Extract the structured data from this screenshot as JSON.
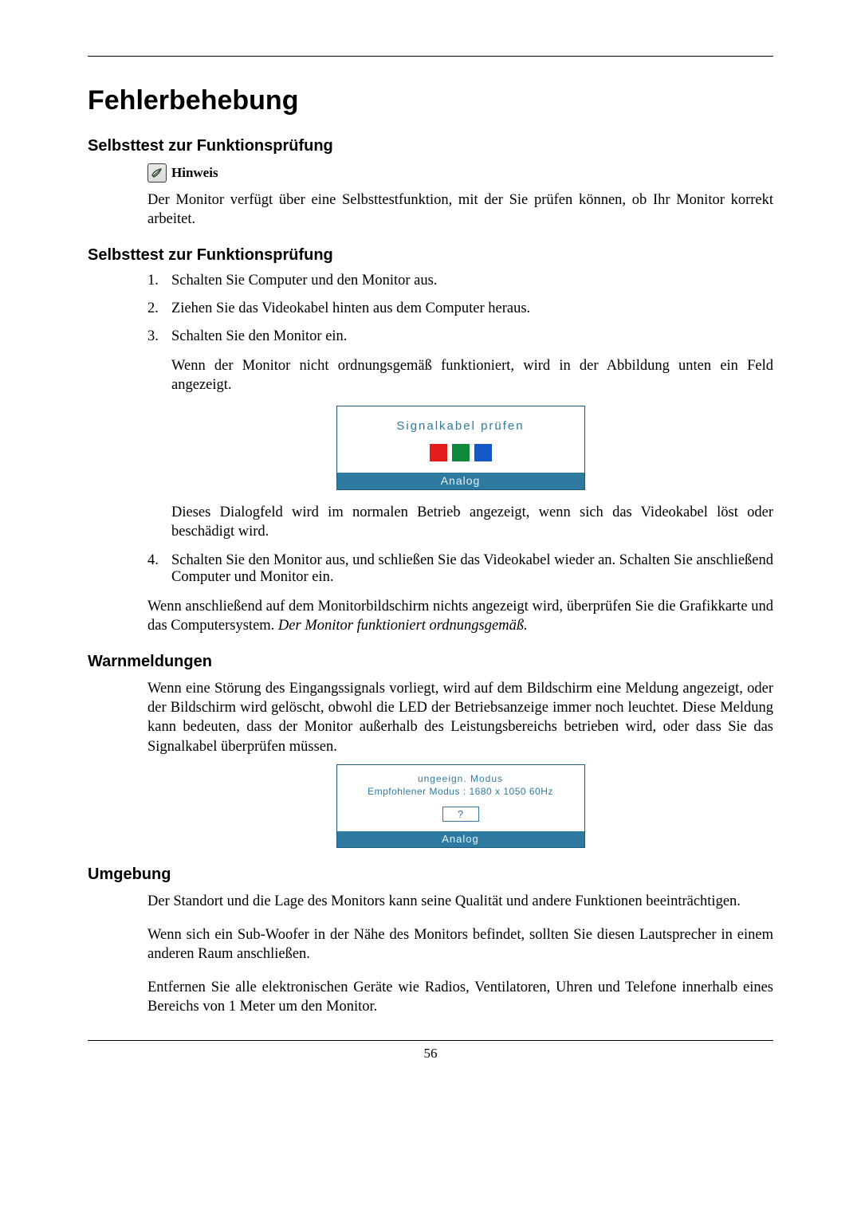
{
  "title": "Fehlerbehebung",
  "section1_title": "Selbsttest zur Funktionsprüfung",
  "hinweis_label": "Hinweis",
  "hinweis_body": "Der Monitor verfügt über eine Selbsttestfunktion, mit der Sie prüfen können, ob Ihr Monitor korrekt arbeitet.",
  "section2_title": "Selbsttest zur Funktionsprüfung",
  "steps": {
    "n1": "1.",
    "t1": "Schalten Sie Computer und den Monitor aus.",
    "n2": "2.",
    "t2": "Ziehen Sie das Videokabel hinten aus dem Computer heraus.",
    "n3": "3.",
    "t3": "Schalten Sie den Monitor ein.",
    "t3b": "Wenn der Monitor nicht ordnungsgemäß funktioniert, wird in der Abbildung unten ein Feld angezeigt.",
    "t3c": "Dieses Dialogfeld wird im normalen Betrieb angezeigt, wenn sich das Videokabel löst oder beschädigt wird.",
    "n4": "4.",
    "t4": "Schalten Sie den Monitor aus, und schließen Sie das Videokabel wieder an. Schalten Sie anschließend Computer und Monitor ein."
  },
  "after_steps_a": "Wenn anschließend auf dem Monitorbildschirm nichts angezeigt wird, überprüfen Sie die Grafikkarte und das Computersystem. ",
  "after_steps_b": "Der Monitor funktioniert ordnungsgemäß.",
  "dialog1": {
    "title": "Signalkabel prüfen",
    "footer": "Analog"
  },
  "section3_title": "Warnmeldungen",
  "warn_body": "Wenn eine Störung des Eingangssignals vorliegt, wird auf dem Bildschirm eine Meldung angezeigt, oder der Bildschirm wird gelöscht, obwohl die LED der Betriebsanzeige immer noch leuchtet. Diese Meldung kann bedeuten, dass der Monitor außerhalb des Leistungsbereichs betrieben wird, oder dass Sie das Signalkabel überprüfen müssen.",
  "dialog2": {
    "line1": "ungeeign. Modus",
    "line2": "Empfohlener Modus : 1680 x 1050  60Hz",
    "q": "?",
    "footer": "Analog"
  },
  "section4_title": "Umgebung",
  "env_p1": "Der Standort und die Lage des Monitors kann seine Qualität und andere Funktionen beeinträchtigen.",
  "env_p2": "Wenn sich ein Sub-Woofer in der Nähe des Monitors befindet, sollten Sie diesen Lautsprecher in einem anderen Raum anschließen.",
  "env_p3": "Entfernen Sie alle elektronischen Geräte wie Radios, Ventilatoren, Uhren und Telefone innerhalb eines Bereichs von 1 Meter um den Monitor.",
  "page_number": "56"
}
